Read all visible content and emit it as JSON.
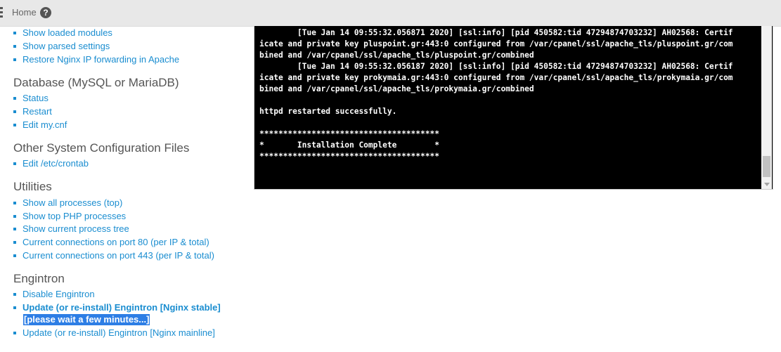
{
  "topbar": {
    "home_label": "Home",
    "help_icon": "question-circle-icon",
    "help_glyph": "?"
  },
  "apache_links": [
    "Show loaded modules",
    "Show parsed settings",
    "Restore Nginx IP forwarding in Apache"
  ],
  "sections": {
    "database": {
      "title": "Database (MySQL or MariaDB)",
      "links": [
        "Status",
        "Restart",
        "Edit my.cnf"
      ]
    },
    "other_config": {
      "title": "Other System Configuration Files",
      "links": [
        "Edit /etc/crontab"
      ]
    },
    "utilities": {
      "title": "Utilities",
      "links": [
        "Show all processes (top)",
        "Show top PHP processes",
        "Show current process tree",
        "Current connections on port 80 (per IP & total)",
        "Current connections on port 443 (per IP & total)"
      ]
    },
    "engintron": {
      "title": "Engintron",
      "links": [
        "Disable Engintron",
        "Update (or re-install) Engintron [Nginx stable]",
        "[please wait a few minutes...]",
        "Update (or re-install) Engintron [Nginx mainline]"
      ]
    }
  },
  "terminal": {
    "lines": [
      "        [Tue Jan 14 09:55:32.056871 2020] [ssl:info] [pid 450582:tid 47294874703232] AH02568: Certif",
      "icate and private key pluspoint.gr:443:0 configured from /var/cpanel/ssl/apache_tls/pluspoint.gr/com",
      "bined and /var/cpanel/ssl/apache_tls/pluspoint.gr/combined",
      "        [Tue Jan 14 09:55:32.056187 2020] [ssl:info] [pid 450582:tid 47294874703232] AH02568: Certif",
      "icate and private key prokymaia.gr:443:0 configured from /var/cpanel/ssl/apache_tls/prokymaia.gr/com",
      "bined and /var/cpanel/ssl/apache_tls/prokymaia.gr/combined",
      "",
      "httpd restarted successfully.",
      "",
      "**************************************",
      "*       Installation Complete        *",
      "**************************************"
    ]
  },
  "colors": {
    "link": "#1a8dd0",
    "selection": "#2d7ee5",
    "terminal_bg": "#000000",
    "topbar_bg": "#e8e8e8"
  }
}
